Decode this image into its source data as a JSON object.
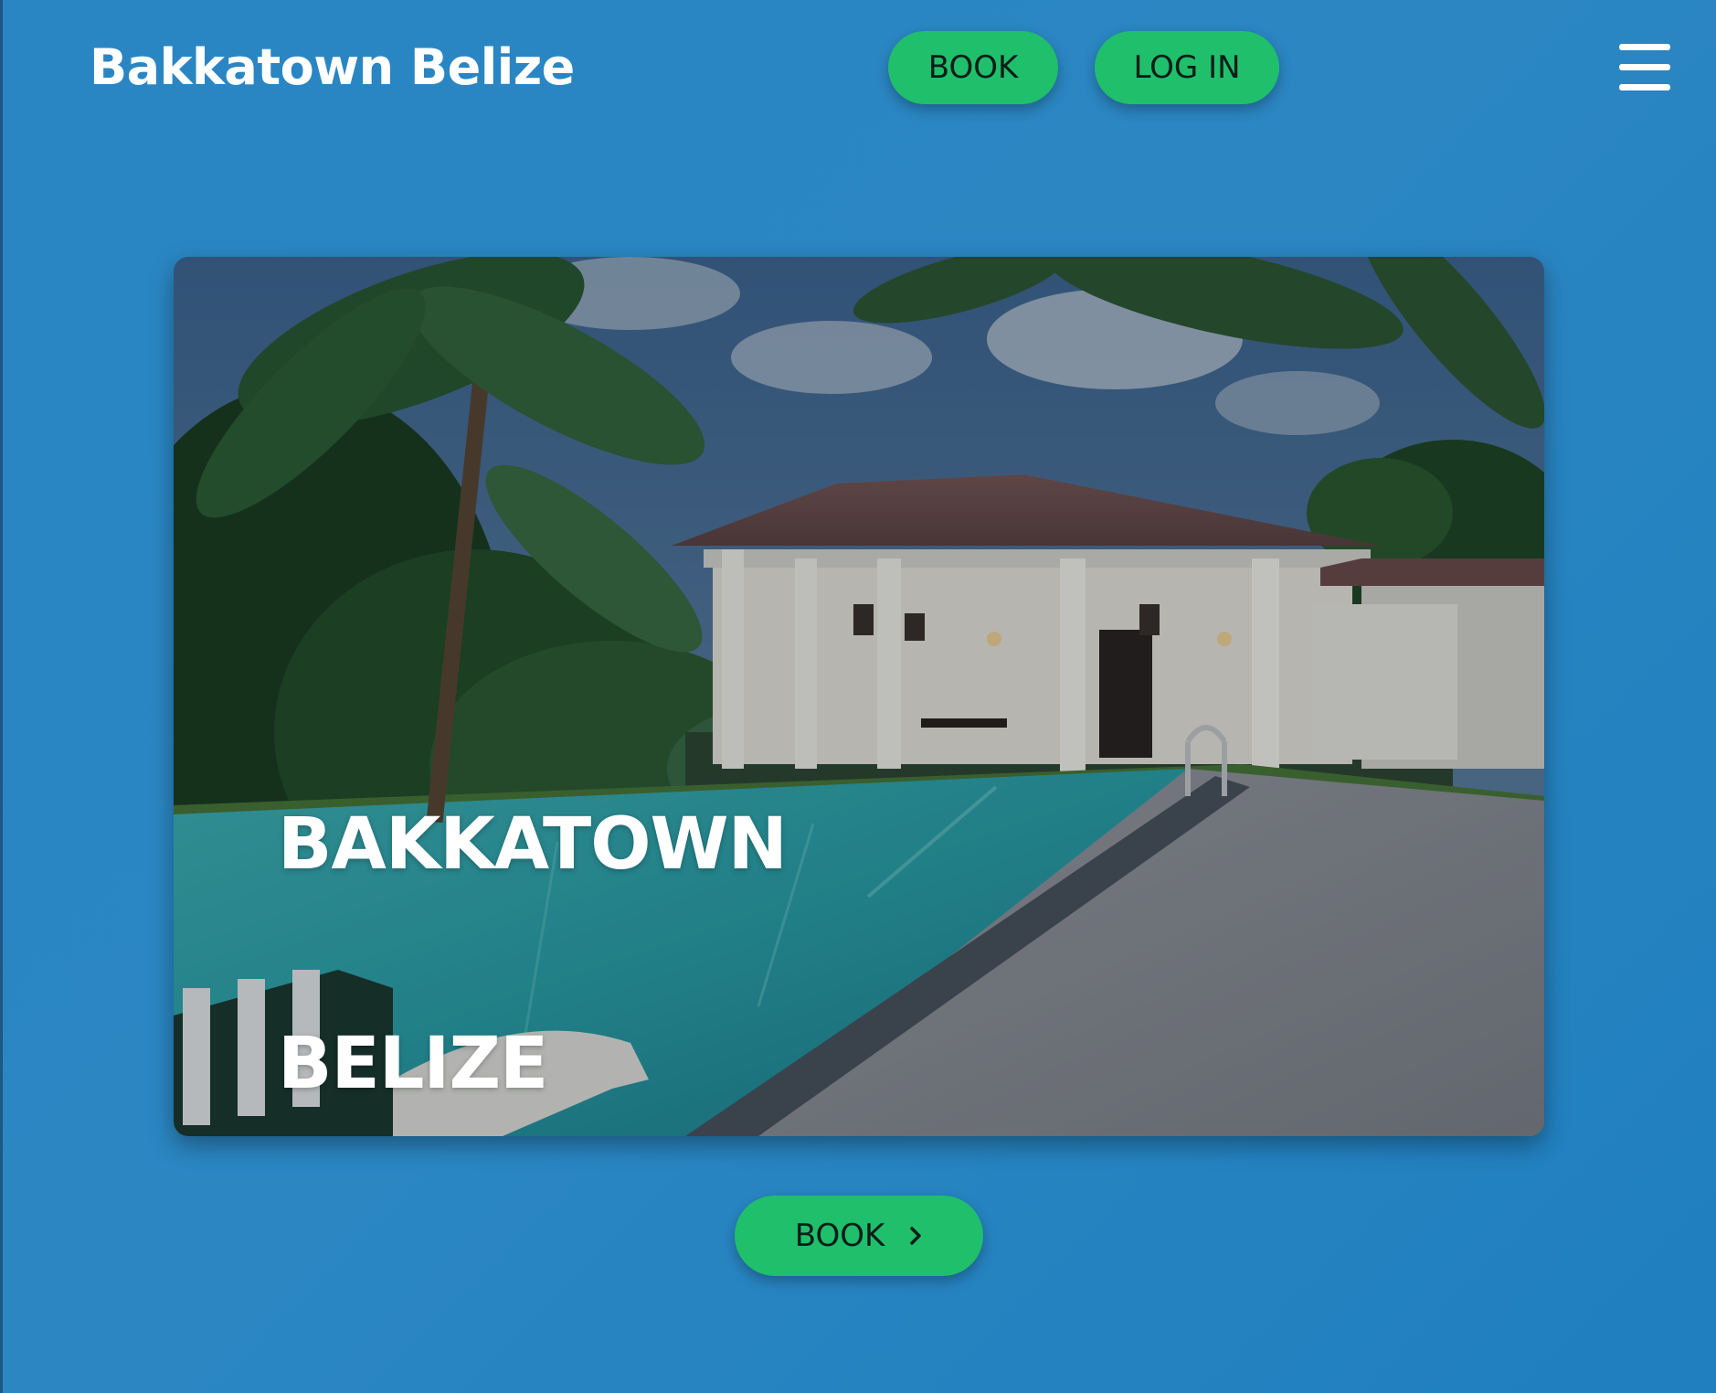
{
  "header": {
    "brand": "Bakkatown Belize",
    "book_label": "BOOK",
    "login_label": "LOG IN",
    "menu_icon": "hamburger-menu-icon"
  },
  "hero": {
    "line1": "BAKKATOWN",
    "line2": "BELIZE",
    "image": "resort-pool-with-palm-trees-photo"
  },
  "cta": {
    "book_label": "BOOK",
    "icon": "chevron-right-icon"
  },
  "colors": {
    "background": "#2a86c3",
    "button": "#20bf6b",
    "button_text": "#0b1c18",
    "brand_text": "#ffffff"
  }
}
